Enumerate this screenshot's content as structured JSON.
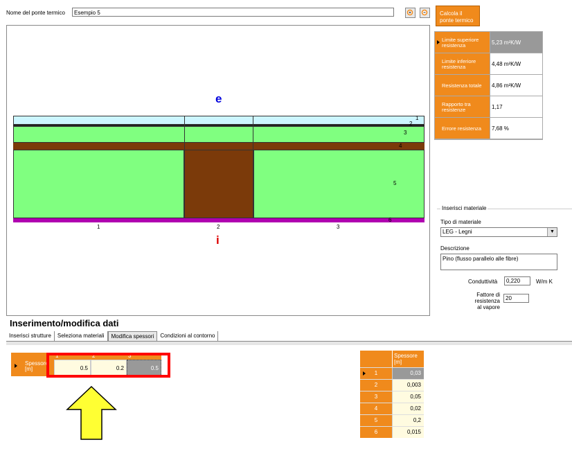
{
  "header": {
    "name_label": "Nome del ponte termico",
    "name_value": "Esempio 5",
    "calc_button": [
      "Calcola il",
      "ponte termico"
    ]
  },
  "drawing": {
    "exterior_label": "e",
    "interior_label": "i",
    "layer_numbers": [
      "1",
      "2",
      "3",
      "4",
      "5",
      "6"
    ],
    "section_numbers": [
      "1",
      "2",
      "3"
    ]
  },
  "results": [
    {
      "label": "Limite superiore resistenza",
      "value": "5,23 m²K/W",
      "selected": true
    },
    {
      "label": "Limite inferiore resistenza",
      "value": "4,48 m²K/W",
      "selected": false
    },
    {
      "label": "Resistenza totale",
      "value": "4,86 m²K/W",
      "selected": false
    },
    {
      "label": "Rapporto tra resistenze",
      "value": "1,17",
      "selected": false
    },
    {
      "label": "Errore resistenza",
      "value": "7,68 %",
      "selected": false
    }
  ],
  "material": {
    "legend": "Inserisci materiale",
    "type_label": "Tipo di materiale",
    "type_value": "LEG - Legni",
    "desc_label": "Descrizione",
    "desc_value": "Pino (flusso parallelo alle fibre)",
    "conductivity_label": "Conduttività",
    "conductivity_value": "0,220",
    "conductivity_unit": "W/m K",
    "vapor_label_1": "Fattore di resistenza",
    "vapor_label_2": "al vapore",
    "vapor_value": "20"
  },
  "bottom": {
    "title": "Inserimento/modifica dati",
    "tabs": [
      "Inserisci strutture",
      "Seleziona materiali",
      "Modifica spessori",
      "Condizioni al contorno"
    ],
    "active_tab": 2,
    "row_header": "Spessore [m]",
    "col_headers": [
      "1",
      "2",
      "3"
    ],
    "col_values": [
      "0.5",
      "0.2",
      "0.5"
    ]
  },
  "thickness_table": {
    "header": "Spessore [m]",
    "rows": [
      {
        "num": "1",
        "value": "0,03"
      },
      {
        "num": "2",
        "value": "0,003"
      },
      {
        "num": "3",
        "value": "0,05"
      },
      {
        "num": "4",
        "value": "0,02"
      },
      {
        "num": "5",
        "value": "0,2"
      },
      {
        "num": "6",
        "value": "0,015"
      }
    ]
  },
  "colors": {
    "orange": "#f08a1c",
    "layer1": "#ccf6ff",
    "layer_green": "#80ff80",
    "layer_wood": "#7b3a0a",
    "layer6": "#b000b0",
    "exterior": "#0000dd",
    "interior": "#dd0000",
    "highlight": "#ff0000",
    "arrow": "#ffff33"
  }
}
